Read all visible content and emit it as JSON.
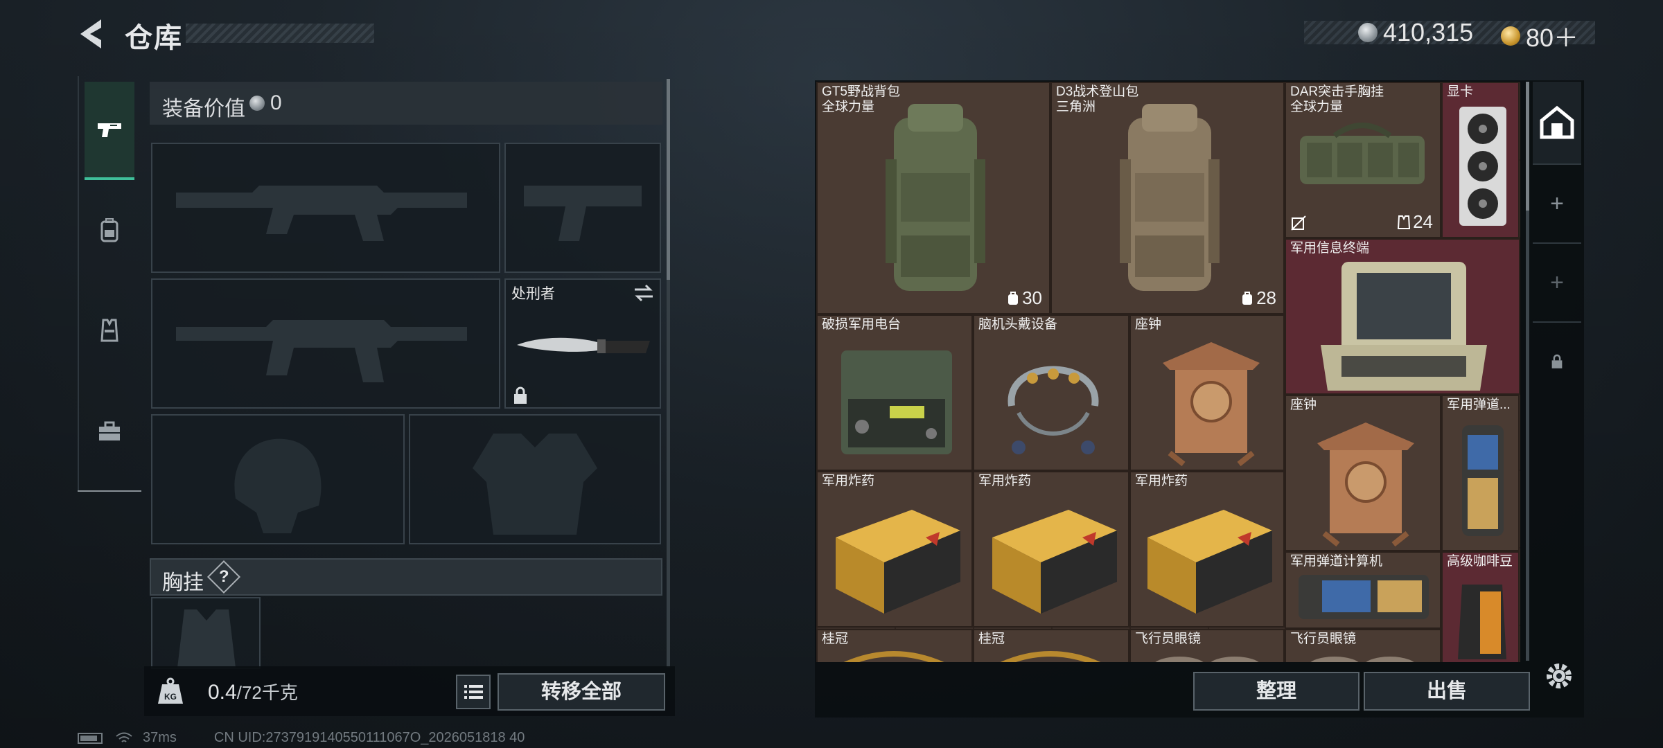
{
  "header": {
    "title": "仓库",
    "currency_silver": "410,315",
    "currency_gold": "80＋"
  },
  "sidebar": {
    "tabs": [
      {
        "name": "weapon",
        "active": true
      },
      {
        "name": "backpack",
        "active": false
      },
      {
        "name": "vest",
        "active": false
      },
      {
        "name": "toolbox",
        "active": false
      }
    ]
  },
  "equipment": {
    "value_label": "装备价值",
    "value": "0",
    "melee_name": "处刑者",
    "vest_section": "胸挂",
    "vest_help": "?"
  },
  "weight": {
    "current": "0.4",
    "max": "/72千克"
  },
  "buttons": {
    "transfer_all": "转移全部",
    "sort": "整理",
    "sell": "出售"
  },
  "inventory": {
    "items": [
      {
        "name": "GT5野战背包",
        "sub": "全球力量",
        "count": "30"
      },
      {
        "name": "D3战术登山包",
        "sub": "三角洲",
        "count": "28"
      },
      {
        "name": "DAR突击手胸挂",
        "sub": "全球力量",
        "count": "24"
      },
      {
        "name": "显卡"
      },
      {
        "name": "军用信息终端"
      },
      {
        "name": "破损军用电台"
      },
      {
        "name": "脑机头戴设备"
      },
      {
        "name": "座钟"
      },
      {
        "name": "座钟"
      },
      {
        "name": "军用弹道..."
      },
      {
        "name": "军用炸药"
      },
      {
        "name": "军用炸药"
      },
      {
        "name": "军用炸药"
      },
      {
        "name": "军用弹道计算机"
      },
      {
        "name": "高级咖啡豆"
      },
      {
        "name": "桂冠"
      },
      {
        "name": "桂冠"
      },
      {
        "name": "飞行员眼镜"
      },
      {
        "name": "飞行员眼镜"
      }
    ]
  },
  "status_bar": {
    "ping": "37ms",
    "uid": "CN UID:2737919140550111067O_2026051818 40"
  },
  "colors": {
    "accent": "#3fbf9a",
    "item_bg": "#4a3b33",
    "rare_bg": "#5c2a33"
  }
}
